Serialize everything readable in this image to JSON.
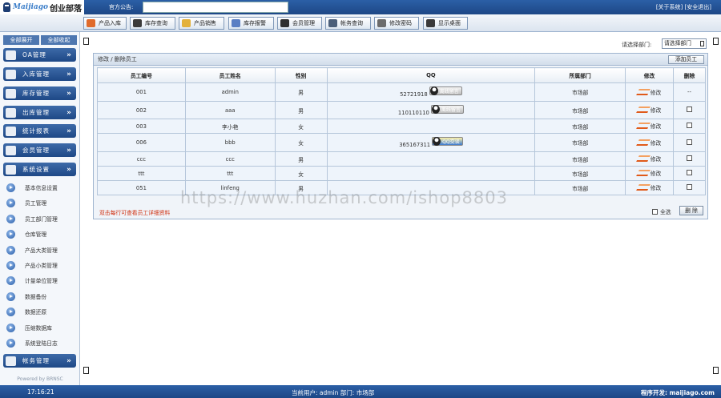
{
  "header": {
    "logo_brand": "Maijiago",
    "logo_cn": "创业部落",
    "notice_label": "官方公告:",
    "notice_value": "",
    "links": [
      "[关于系统]",
      "[安全退出]"
    ]
  },
  "toolbar": {
    "items": [
      {
        "label": "产品入库",
        "icon": "product-in-icon"
      },
      {
        "label": "库存查询",
        "icon": "stock-query-icon"
      },
      {
        "label": "产品销售",
        "icon": "product-sale-icon"
      },
      {
        "label": "库存报警",
        "icon": "stock-alarm-icon"
      },
      {
        "label": "会员管理",
        "icon": "member-icon"
      },
      {
        "label": "帐务查询",
        "icon": "account-query-icon"
      },
      {
        "label": "修改密码",
        "icon": "password-icon"
      },
      {
        "label": "显示桌面",
        "icon": "desktop-icon"
      }
    ]
  },
  "sidebar": {
    "expand_all": "全部展开",
    "collapse_all": "全部收起",
    "menus": [
      "OA管理",
      "入库管理",
      "库存管理",
      "出库管理",
      "统计报表",
      "会员管理",
      "系统设置"
    ],
    "system_items": [
      "基本信息设置",
      "员工管理",
      "员工部门管理",
      "仓库管理",
      "产品大类管理",
      "产品小类管理",
      "计量单位管理",
      "数据备份",
      "数据还原",
      "压缩数据库",
      "系统登陆日志"
    ],
    "account_menu": "帐务管理",
    "powered": "Powered by BRNSC"
  },
  "main": {
    "dept_label": "请选择部门:",
    "dept_select": "请选择部门",
    "panel_title": "修改 / 删除员工",
    "add_button": "添加员工",
    "columns": [
      "员工编号",
      "员工姓名",
      "性别",
      "QQ",
      "所属部门",
      "修改",
      "删除"
    ],
    "rows": [
      {
        "id": "001",
        "name": "admin",
        "gender": "男",
        "qq": "52721918",
        "qq_status": "离线留言",
        "dept": "市场部",
        "edit": "修改",
        "delete": "--"
      },
      {
        "id": "002",
        "name": "aaa",
        "gender": "男",
        "qq": "110110110",
        "qq_status": "离线留言",
        "dept": "市场部",
        "edit": "修改",
        "delete": ""
      },
      {
        "id": "003",
        "name": "李小艳",
        "gender": "女",
        "qq": "",
        "qq_status": "",
        "dept": "市场部",
        "edit": "修改",
        "delete": ""
      },
      {
        "id": "006",
        "name": "bbb",
        "gender": "女",
        "qq": "365167311",
        "qq_status": "QQ交谈",
        "dept": "市场部",
        "edit": "修改",
        "delete": ""
      },
      {
        "id": "ccc",
        "name": "ccc",
        "gender": "男",
        "qq": "",
        "qq_status": "",
        "dept": "市场部",
        "edit": "修改",
        "delete": ""
      },
      {
        "id": "ttt",
        "name": "ttt",
        "gender": "女",
        "qq": "",
        "qq_status": "",
        "dept": "市场部",
        "edit": "修改",
        "delete": ""
      },
      {
        "id": "051",
        "name": "linfeng",
        "gender": "男",
        "qq": "",
        "qq_status": "",
        "dept": "市场部",
        "edit": "修改",
        "delete": ""
      }
    ],
    "footnote": "双击每行可查看员工详细资料",
    "select_all": "全选",
    "delete_button": "删 除"
  },
  "watermark": "https://www.huzhan.com/ishop8803",
  "status": {
    "clock": "17:16:21",
    "current_user": "当前用户: admin  部门: 市场部",
    "developer": "程序开发: maijiago.com"
  }
}
